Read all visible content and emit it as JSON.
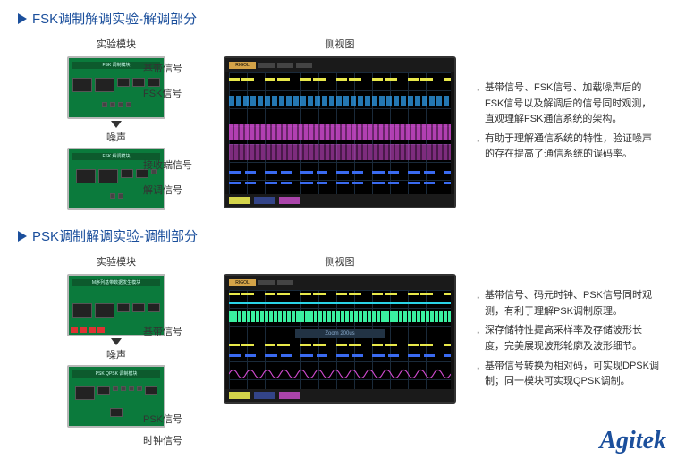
{
  "section1": {
    "title": "FSK调制解调实验-解调部分",
    "module_label": "实验模块",
    "scope_label": "侧视图",
    "noise_label": "噪声",
    "signals_top": [
      "基带信号",
      "FSK信号"
    ],
    "signals_bottom": [
      "接收端信号",
      "解调信号"
    ],
    "scope_brand": "RIGOL",
    "bullets": [
      "基带信号、FSK信号、加载噪声后的FSK信号以及解调后的信号同时观测，直观理解FSK通信系统的架构。",
      "有助于理解通信系统的特性，验证噪声的存在提高了通信系统的误码率。"
    ]
  },
  "section2": {
    "title": "PSK调制解调实验-调制部分",
    "module_label": "实验模块",
    "scope_label": "侧视图",
    "noise_label": "噪声",
    "signals_top": [
      "基带信号"
    ],
    "signals_bottom": [
      "PSK信号",
      "时钟信号"
    ],
    "scope_brand": "RIGOL",
    "scope_zoom": "Zoom 200us",
    "bullets": [
      "基带信号、码元时钟、PSK信号同时观测，有利于理解PSK调制原理。",
      "深存储特性提高采样率及存储波形长度，完美展现波形轮廓及波形细节。",
      "基带信号转换为相对码，可实现DPSK调制；同一模块可实现QPSK调制。"
    ]
  },
  "brand": "Agitek"
}
